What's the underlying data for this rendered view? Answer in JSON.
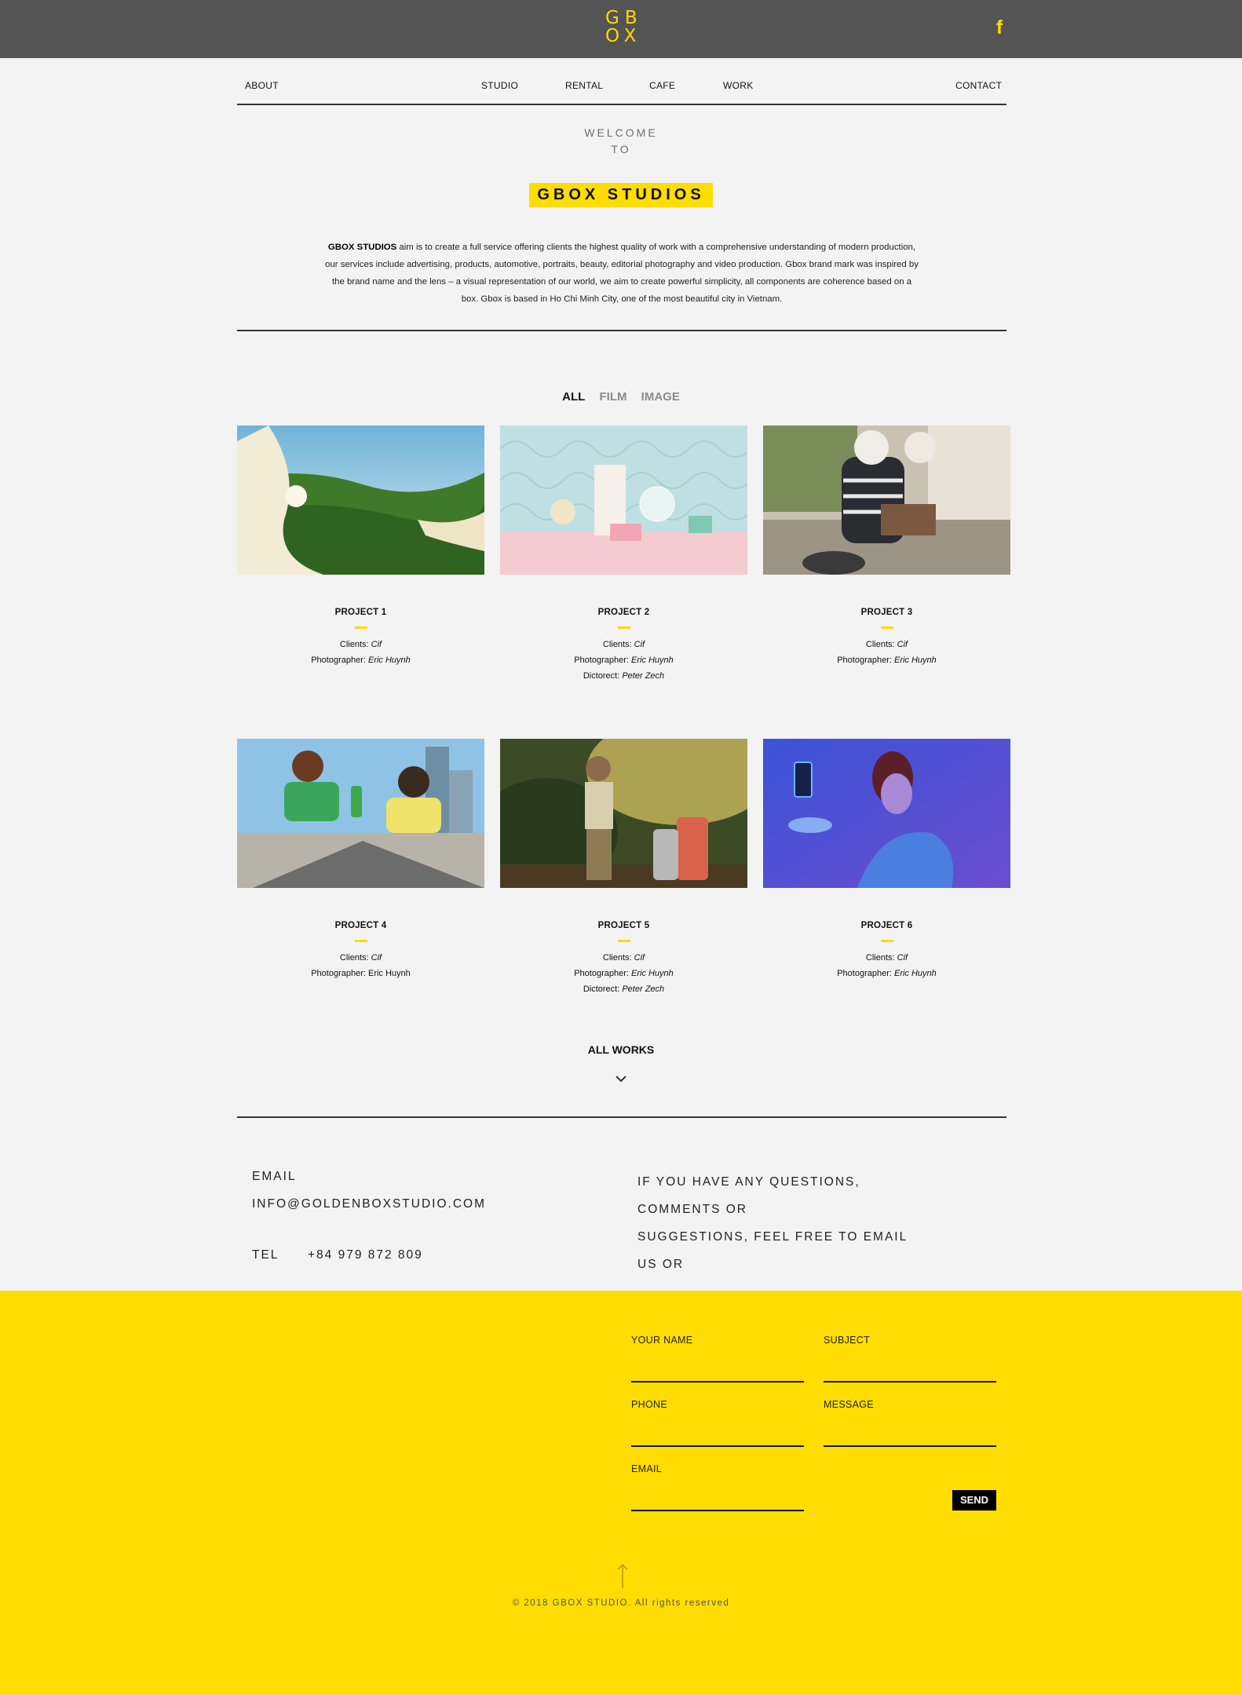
{
  "header": {
    "logo_top": "GB",
    "logo_bottom": "OX",
    "social_icon": "facebook-icon",
    "social_glyph": "f"
  },
  "nav": {
    "about": "ABOUT",
    "studio": "STUDIO",
    "rental": "RENTAL",
    "cafe": "CAFE",
    "work": "WORK",
    "contact": "CONTACT"
  },
  "welcome": {
    "line1": "WELCOME",
    "line2": "TO",
    "title": "GBOX STUDIOS",
    "intro_brand": "GBOX STUDIOS",
    "intro_text": " aim is to create a full service offering clients the highest quality of work with a comprehensive understanding of modern production, our services include advertising, products, automotive, portraits, beauty, editorial photography and video production. Gbox brand mark was inspired by the brand name and the lens – a visual representation of our world, we aim to create powerful simplicity, all components are coherence based on a box. Gbox is based in Ho Chi Minh City, one of the most beautiful city in Vietnam."
  },
  "filters": {
    "all": "ALL",
    "film": "FILM",
    "image": "IMAGE"
  },
  "labels": {
    "clients": "Clients: ",
    "photographer": "Photographer: ",
    "dictorect": "Dictorect: "
  },
  "projects": [
    {
      "title": "PROJECT 1",
      "clients": "Cif",
      "photographer": "Eric Huynh",
      "dictorect": ""
    },
    {
      "title": "PROJECT 2",
      "clients": "Cif",
      "photographer": "Eric Huynh",
      "dictorect": "Peter Zech"
    },
    {
      "title": "PROJECT 3",
      "clients": "Cif",
      "photographer": "Eric Huynh",
      "dictorect": ""
    },
    {
      "title": "PROJECT 4",
      "clients": "Cif",
      "photographer": "Eric Huynh",
      "dictorect": ""
    },
    {
      "title": "PROJECT 5",
      "clients": "Cif",
      "photographer": "Eric Huynh",
      "dictorect": "Peter Zech"
    },
    {
      "title": "PROJECT 6",
      "clients": "Cif",
      "photographer": "Eric Huynh",
      "dictorect": ""
    }
  ],
  "all_works": "ALL WORKS",
  "contact": {
    "email_label": "EMAIL",
    "email": "INFO@GOLDENBOXSTUDIO.COM",
    "tel_label": "TEL",
    "tel": "+84 979 872 809",
    "question_lines": [
      "IF YOU HAVE ANY QUESTIONS,",
      "COMMENTS OR",
      "SUGGESTIONS, FEEL FREE TO EMAIL",
      "US OR"
    ]
  },
  "form": {
    "name_label": "YOUR NAME",
    "subject_label": "SUBJECT",
    "phone_label": "PHONE",
    "message_label": "MESSAGE",
    "email_label": "EMAIL",
    "send": "SEND"
  },
  "footer": {
    "copyright": "© 2018 GBOX STUDIO. All rights reserved"
  },
  "colors": {
    "accent": "#ffdd00",
    "topbar": "#545454",
    "background": "#f3f3f3"
  }
}
